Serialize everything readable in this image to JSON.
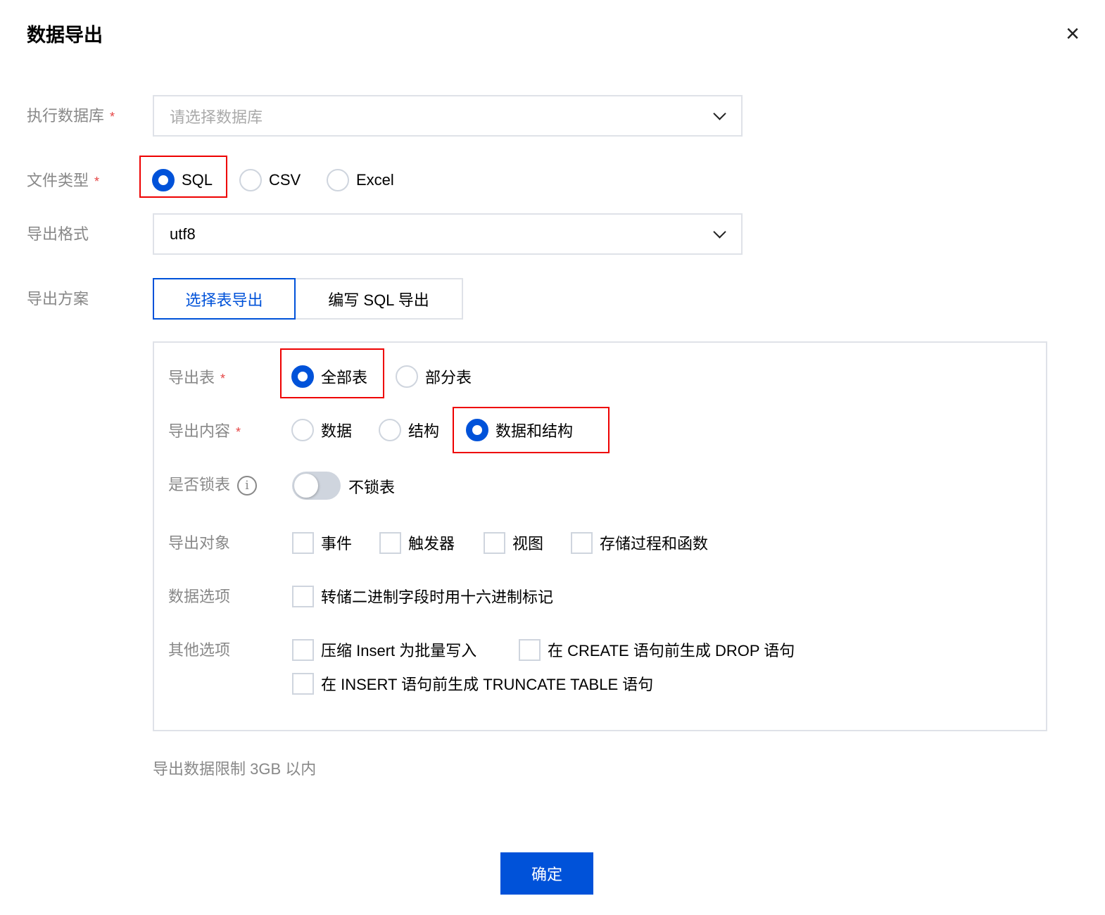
{
  "dialog": {
    "title": "数据导出",
    "close_icon": "close-icon"
  },
  "form": {
    "database": {
      "label": "执行数据库",
      "placeholder": "请选择数据库"
    },
    "file_type": {
      "label": "文件类型",
      "options": [
        "SQL",
        "CSV",
        "Excel"
      ],
      "selected": "SQL"
    },
    "encoding": {
      "label": "导出格式",
      "value": "utf8"
    },
    "scheme": {
      "label": "导出方案",
      "tabs": [
        "选择表导出",
        "编写 SQL 导出"
      ],
      "active": "选择表导出"
    }
  },
  "panel": {
    "tables": {
      "label": "导出表",
      "options": [
        "全部表",
        "部分表"
      ],
      "selected": "全部表"
    },
    "content": {
      "label": "导出内容",
      "options": [
        "数据",
        "结构",
        "数据和结构"
      ],
      "selected": "数据和结构"
    },
    "lock": {
      "label": "是否锁表",
      "info_glyph": "i",
      "toggle_text": "不锁表",
      "on": false
    },
    "objects": {
      "label": "导出对象",
      "options": [
        "事件",
        "触发器",
        "视图",
        "存储过程和函数"
      ]
    },
    "data_options": {
      "label": "数据选项",
      "options": [
        "转储二进制字段时用十六进制标记"
      ]
    },
    "other_options": {
      "label": "其他选项",
      "options": [
        "压缩 Insert 为批量写入",
        "在 CREATE 语句前生成 DROP 语句",
        "在 INSERT 语句前生成 TRUNCATE TABLE 语句"
      ]
    }
  },
  "note": "导出数据限制 3GB 以内",
  "confirm_label": "确定",
  "required_mark": "*",
  "colors": {
    "primary": "#0052d9",
    "highlight": "#e00000",
    "required": "#e54545"
  }
}
